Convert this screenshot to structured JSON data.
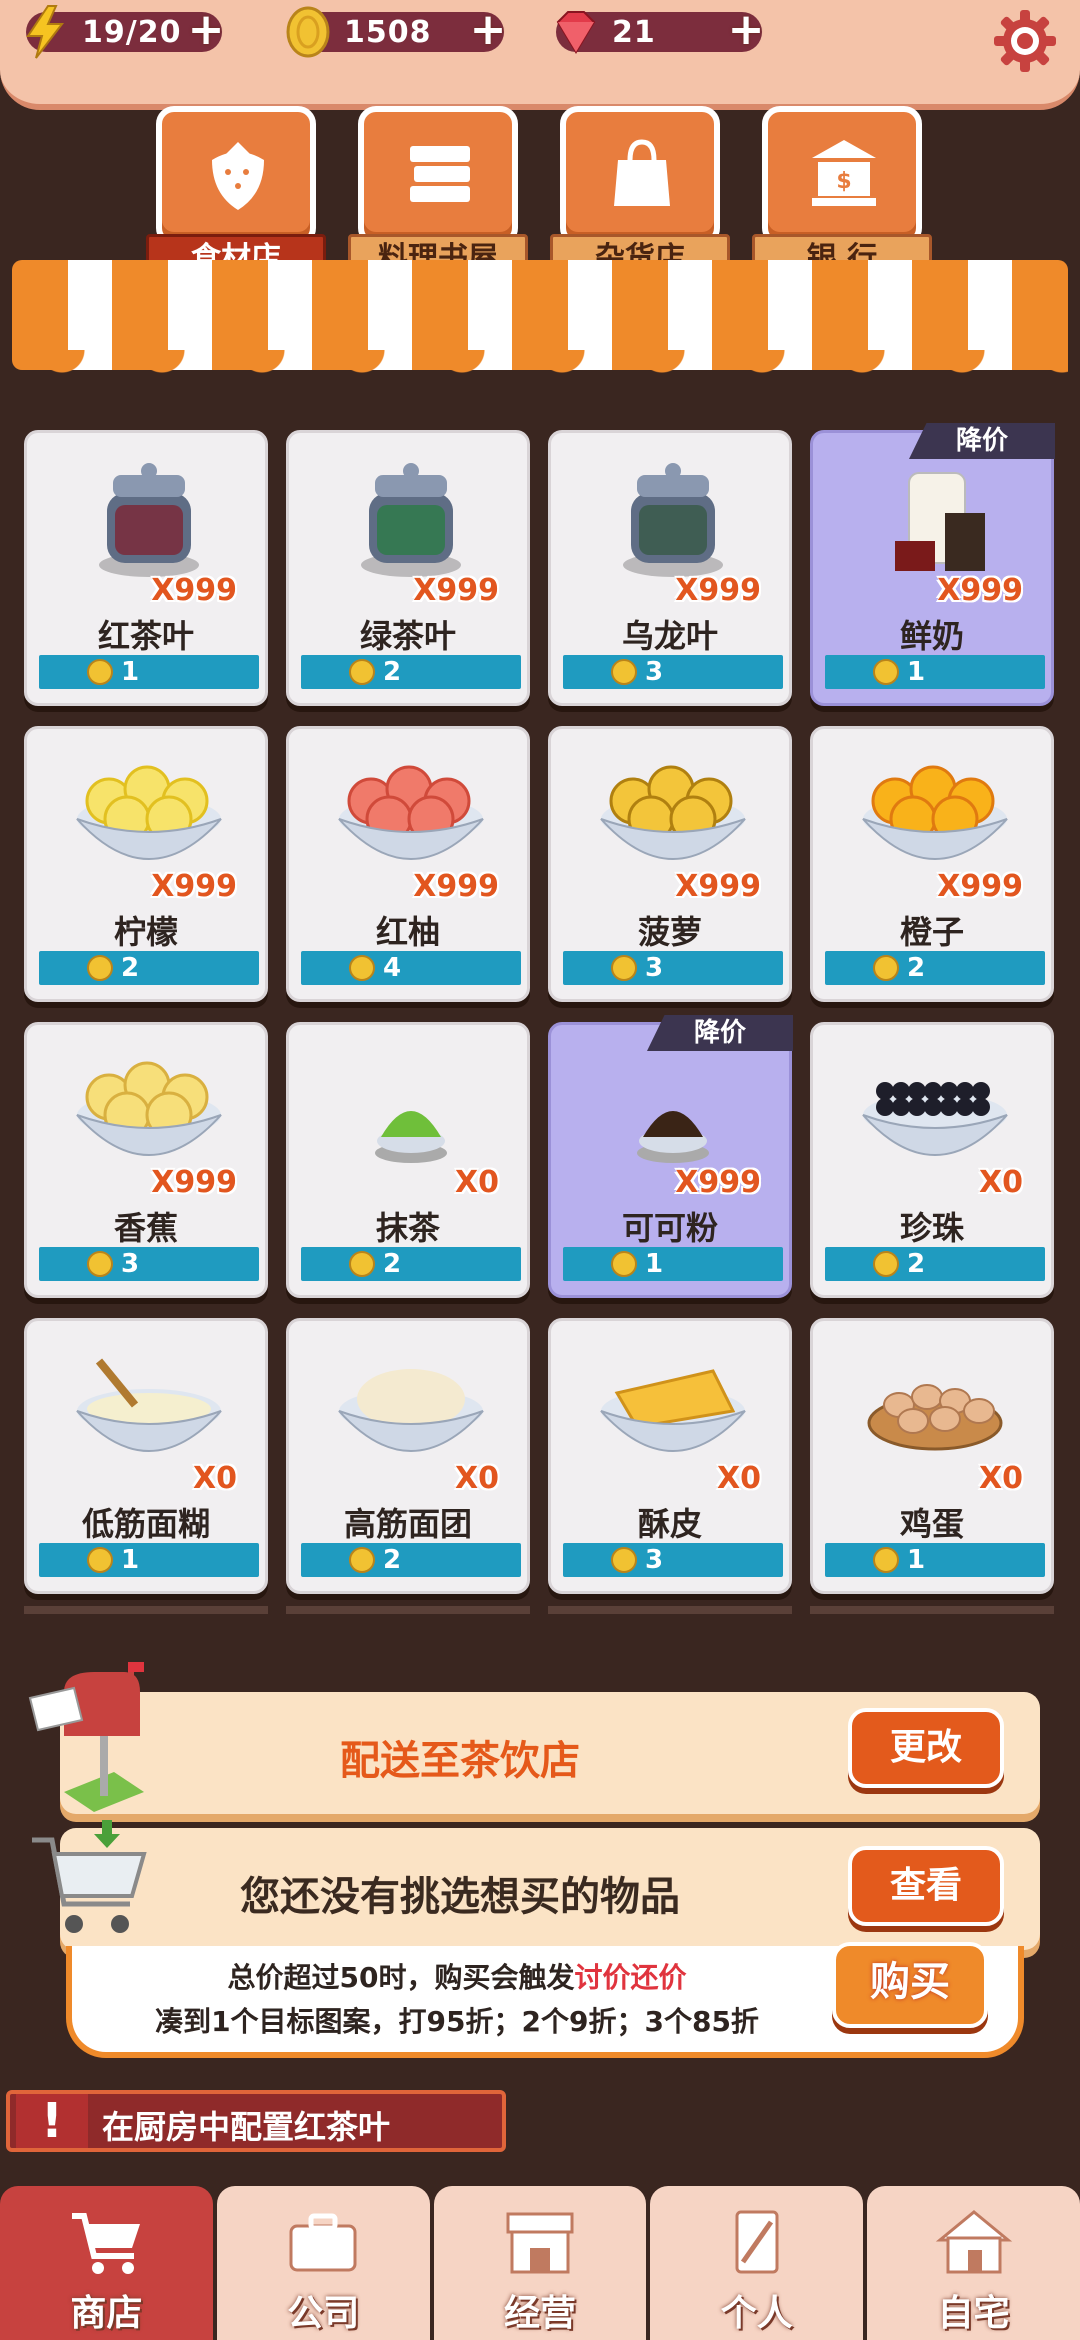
{
  "status": {
    "energy": {
      "value": "19/20",
      "icon": "lightning-icon"
    },
    "coins": {
      "value": "1508",
      "icon": "coin-icon"
    },
    "gems": {
      "value": "21",
      "icon": "gem-icon"
    },
    "plus": "+"
  },
  "tabs": [
    {
      "label": "食材店",
      "icon": "strawberry-icon",
      "active": true
    },
    {
      "label": "料理书屋",
      "icon": "books-icon",
      "active": false
    },
    {
      "label": "杂货店",
      "icon": "shopping-bag-icon",
      "active": false
    },
    {
      "label": "银 行",
      "icon": "bank-icon",
      "active": false
    }
  ],
  "items": [
    {
      "name": "红茶叶",
      "qty": "X999",
      "price": "1",
      "sale": false,
      "icon": "black-tea-jar-icon"
    },
    {
      "name": "绿茶叶",
      "qty": "X999",
      "price": "2",
      "sale": false,
      "icon": "green-tea-jar-icon"
    },
    {
      "name": "乌龙叶",
      "qty": "X999",
      "price": "3",
      "sale": false,
      "icon": "oolong-jar-icon"
    },
    {
      "name": "鲜奶",
      "qty": "X999",
      "price": "1",
      "sale": true,
      "icon": "milk-icon"
    },
    {
      "name": "柠檬",
      "qty": "X999",
      "price": "2",
      "sale": false,
      "icon": "lemon-bowl-icon"
    },
    {
      "name": "红柚",
      "qty": "X999",
      "price": "4",
      "sale": false,
      "icon": "grapefruit-bowl-icon"
    },
    {
      "name": "菠萝",
      "qty": "X999",
      "price": "3",
      "sale": false,
      "icon": "pineapple-bowl-icon"
    },
    {
      "name": "橙子",
      "qty": "X999",
      "price": "2",
      "sale": false,
      "icon": "orange-bowl-icon"
    },
    {
      "name": "香蕉",
      "qty": "X999",
      "price": "3",
      "sale": false,
      "icon": "banana-bowl-icon"
    },
    {
      "name": "抹茶",
      "qty": "X0",
      "price": "2",
      "sale": false,
      "icon": "matcha-powder-icon"
    },
    {
      "name": "可可粉",
      "qty": "X999",
      "price": "1",
      "sale": true,
      "icon": "cocoa-powder-icon"
    },
    {
      "name": "珍珠",
      "qty": "X0",
      "price": "2",
      "sale": false,
      "icon": "pearls-bowl-icon"
    },
    {
      "name": "低筋面糊",
      "qty": "X0",
      "price": "1",
      "sale": false,
      "icon": "batter-bowl-icon"
    },
    {
      "name": "高筋面团",
      "qty": "X0",
      "price": "2",
      "sale": false,
      "icon": "dough-bowl-icon"
    },
    {
      "name": "酥皮",
      "qty": "X0",
      "price": "3",
      "sale": false,
      "icon": "pastry-bowl-icon"
    },
    {
      "name": "鸡蛋",
      "qty": "X0",
      "price": "1",
      "sale": false,
      "icon": "eggs-basket-icon"
    }
  ],
  "sale_tag": "降价",
  "delivery": {
    "text": "配送至茶饮店",
    "button": "更改"
  },
  "cart": {
    "text": "您还没有挑选想买的物品",
    "button": "查看"
  },
  "purchase": {
    "line1_prefix": "总价超过50时，购买会触发",
    "line1_highlight": "讨价还价",
    "line2": "凑到1个目标图案，打95折；2个9折；3个85折",
    "button": "购买"
  },
  "hint": {
    "icon": "!",
    "text": "在厨房中配置红茶叶"
  },
  "nav": [
    {
      "label": "商店",
      "icon": "cart-icon",
      "active": true
    },
    {
      "label": "公司",
      "icon": "briefcase-icon",
      "active": false
    },
    {
      "label": "经营",
      "icon": "storefront-icon",
      "active": false
    },
    {
      "label": "个人",
      "icon": "card-icon",
      "active": false
    },
    {
      "label": "自宅",
      "icon": "house-icon",
      "active": false
    }
  ],
  "colors": {
    "accent": "#ef8a2a",
    "active_tab": "#b7341b",
    "price_bar": "#1f9bc0",
    "sale_card": "#b8b0ee",
    "nav_active": "#c7423f"
  }
}
